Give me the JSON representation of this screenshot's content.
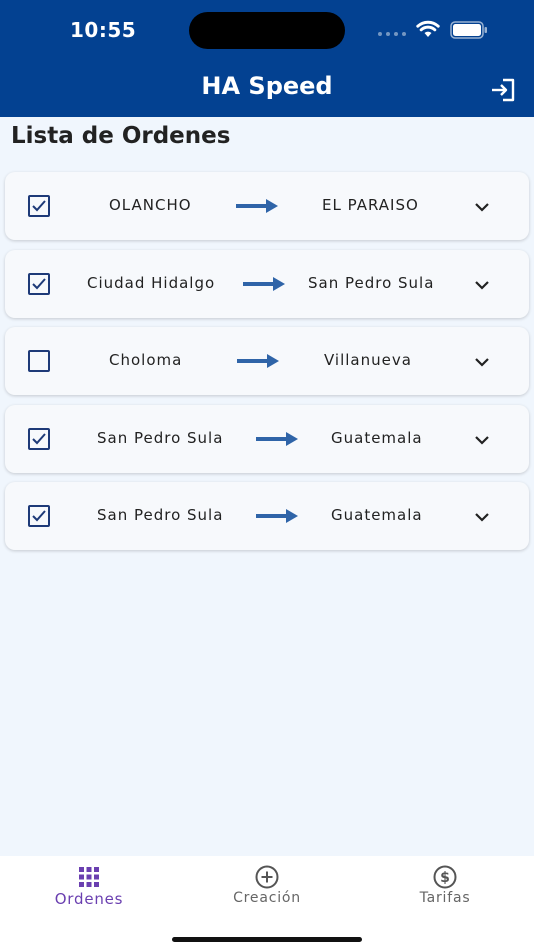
{
  "status_bar": {
    "time": "10:55"
  },
  "header": {
    "title": "HA Speed",
    "logout_icon": "logout-icon"
  },
  "page": {
    "title": "Lista de Ordenes"
  },
  "orders": [
    {
      "checked": true,
      "from": "OLANCHO",
      "to": "EL PARAISO"
    },
    {
      "checked": true,
      "from": "Ciudad Hidalgo",
      "to": "San Pedro Sula"
    },
    {
      "checked": false,
      "from": "Choloma",
      "to": "Villanueva"
    },
    {
      "checked": true,
      "from": "San Pedro Sula",
      "to": "Guatemala"
    },
    {
      "checked": true,
      "from": "San Pedro Sula",
      "to": "Guatemala"
    }
  ],
  "bottom_nav": {
    "items": [
      {
        "label": "Ordenes",
        "icon": "grid-icon",
        "active": true
      },
      {
        "label": "Creación",
        "icon": "plus-circle-icon",
        "active": false
      },
      {
        "label": "Tarifas",
        "icon": "dollar-circle-icon",
        "active": false
      }
    ]
  },
  "colors": {
    "header": "#034191",
    "background": "#f0f6fd",
    "arrow": "#2f64a8",
    "active_nav": "#6a3fb0",
    "checkbox": "#1e3a78"
  }
}
